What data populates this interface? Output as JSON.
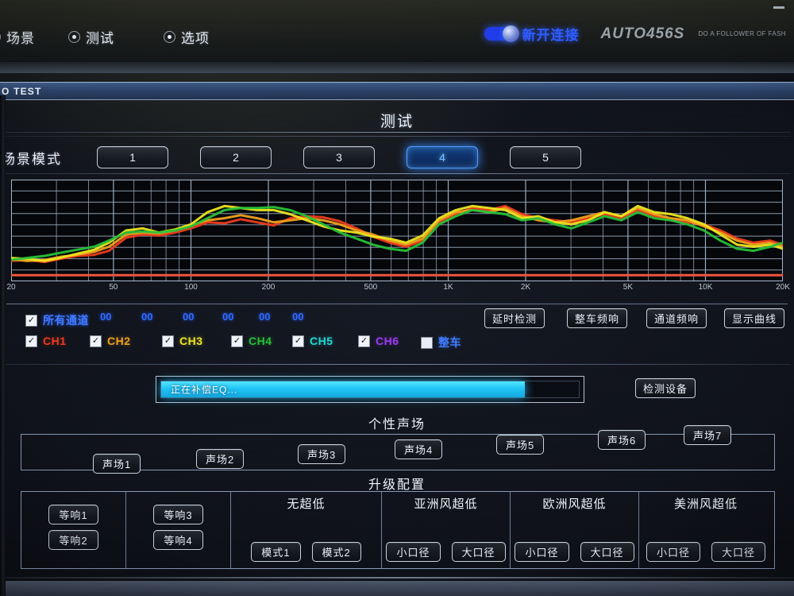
{
  "window": {
    "title": "O TEST",
    "minimize_icon": "minimize-icon"
  },
  "menubar": {
    "items": [
      {
        "label": "场景",
        "selected": false
      },
      {
        "label": "测试",
        "selected": true
      },
      {
        "label": "选项",
        "selected": false
      }
    ],
    "brand": {
      "cn": "新开连接",
      "latin": "AUTO456S",
      "tagline": "DO A FOLLOWER OF FASH",
      "toggle_icon": "bluetooth-toggle-icon"
    }
  },
  "app": {
    "title": "测试"
  },
  "scene_mode": {
    "label": "场景模式",
    "buttons": [
      "1",
      "2",
      "3",
      "4",
      "5"
    ],
    "selected": "4"
  },
  "chart_data": {
    "type": "line",
    "title": "",
    "xlabel": "",
    "ylabel": "",
    "grid": true,
    "x_log": true,
    "xlim": [
      20,
      20000
    ],
    "ylim": [
      0,
      100
    ],
    "tick_labels": [
      "20",
      "50",
      "100",
      "200",
      "500",
      "1K",
      "2K",
      "5K",
      "10K",
      "20K"
    ],
    "tick_values": [
      20,
      50,
      100,
      200,
      500,
      1000,
      2000,
      5000,
      10000,
      20000
    ],
    "x": [
      20,
      23,
      27,
      31,
      36,
      42,
      48,
      56,
      65,
      75,
      87,
      100,
      116,
      135,
      156,
      181,
      210,
      243,
      282,
      327,
      379,
      440,
      510,
      591,
      686,
      795,
      922,
      1070,
      1240,
      1438,
      1668,
      1934,
      2243,
      2601,
      3017,
      3499,
      4057,
      4705,
      5456,
      6327,
      7337,
      8509,
      9868,
      11444,
      13272,
      15391,
      17848,
      20000
    ],
    "series": [
      {
        "name": "CH1",
        "color": "#ee3b1e",
        "values": [
          20,
          21,
          19,
          22,
          25,
          26,
          30,
          43,
          46,
          45,
          48,
          52,
          58,
          57,
          61,
          58,
          55,
          62,
          64,
          63,
          59,
          52,
          44,
          38,
          34,
          40,
          58,
          66,
          72,
          70,
          74,
          66,
          62,
          60,
          58,
          62,
          66,
          62,
          70,
          64,
          60,
          58,
          56,
          50,
          42,
          38,
          40,
          36
        ]
      },
      {
        "name": "CH2",
        "color": "#f0a11c",
        "values": [
          22,
          20,
          21,
          24,
          26,
          29,
          34,
          46,
          48,
          47,
          50,
          55,
          60,
          62,
          65,
          62,
          58,
          60,
          62,
          60,
          56,
          50,
          46,
          40,
          36,
          42,
          60,
          68,
          70,
          68,
          72,
          64,
          60,
          58,
          60,
          64,
          68,
          64,
          72,
          66,
          62,
          60,
          54,
          48,
          40,
          36,
          38,
          34
        ]
      },
      {
        "name": "CH3",
        "color": "#ece61f",
        "values": [
          23,
          22,
          20,
          23,
          27,
          31,
          38,
          50,
          52,
          48,
          51,
          56,
          68,
          74,
          72,
          70,
          70,
          66,
          60,
          54,
          50,
          48,
          44,
          42,
          38,
          45,
          62,
          70,
          74,
          72,
          70,
          62,
          64,
          58,
          56,
          60,
          68,
          64,
          74,
          68,
          66,
          62,
          56,
          46,
          36,
          34,
          36,
          32
        ]
      },
      {
        "name": "CH4",
        "color": "#27c037",
        "values": [
          21,
          23,
          25,
          28,
          31,
          34,
          40,
          48,
          49,
          48,
          50,
          54,
          62,
          70,
          72,
          72,
          73,
          70,
          64,
          56,
          48,
          42,
          36,
          32,
          30,
          38,
          56,
          64,
          70,
          68,
          66,
          60,
          62,
          56,
          52,
          58,
          64,
          60,
          68,
          62,
          60,
          56,
          50,
          40,
          32,
          30,
          34,
          38
        ]
      }
    ],
    "baseline": {
      "name": "baseline",
      "color": "#f0543c",
      "value": 6
    },
    "legend_position": "below-chart"
  },
  "channels": {
    "all": {
      "label": "所有通道",
      "checked": true,
      "color": "#3f7bff"
    },
    "values": [
      "00",
      "00",
      "00",
      "00",
      "00",
      "00"
    ],
    "items": [
      {
        "label": "CH1",
        "checked": true,
        "color": "#ee3b1e"
      },
      {
        "label": "CH2",
        "checked": true,
        "color": "#f0a11c"
      },
      {
        "label": "CH3",
        "checked": true,
        "color": "#ece61f"
      },
      {
        "label": "CH4",
        "checked": true,
        "color": "#27c037"
      },
      {
        "label": "CH5",
        "checked": true,
        "color": "#1fd9d2"
      },
      {
        "label": "CH6",
        "checked": true,
        "color": "#9b3bf0"
      },
      {
        "label": "整车",
        "checked": false,
        "color": "#3f7bff"
      }
    ]
  },
  "actions": {
    "delay_test": "延时检测",
    "vehicle_response": "整车频响",
    "channel_response": "通道频响",
    "show_curve": "显示曲线",
    "detect_device": "检测设备"
  },
  "progress": {
    "text": "正在补偿EQ...",
    "percent": 87
  },
  "sound_field": {
    "title": "个性声场",
    "buttons": [
      "声场1",
      "声场2",
      "声场3",
      "声场4",
      "声场5",
      "声场6",
      "声场7"
    ]
  },
  "upgrade": {
    "title": "升级配置",
    "columns": [
      {
        "head": "",
        "buttons": [
          "等响1",
          "等响2"
        ],
        "layout": "stack"
      },
      {
        "head": "",
        "buttons": [
          "等响3",
          "等响4"
        ],
        "layout": "stack"
      },
      {
        "head": "无超低",
        "buttons": [
          "模式1",
          "模式2"
        ],
        "layout": "row"
      },
      {
        "head": "亚洲风超低",
        "buttons": [
          "小口径",
          "大口径"
        ],
        "layout": "row"
      },
      {
        "head": "欧洲风超低",
        "buttons": [
          "小口径",
          "大口径"
        ],
        "layout": "row"
      },
      {
        "head": "美洲风超低",
        "buttons": [
          "小口径",
          "大口径"
        ],
        "layout": "row"
      }
    ]
  }
}
